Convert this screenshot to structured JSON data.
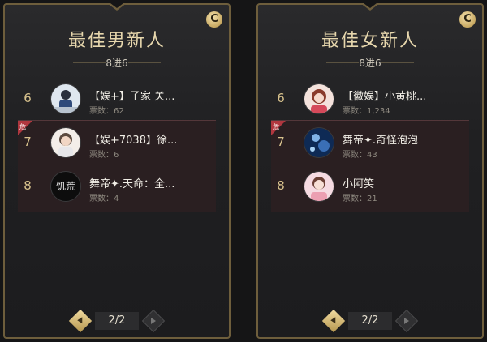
{
  "panels": [
    {
      "title": "最佳男新人",
      "subtitle": "8进6",
      "coin": "C",
      "danger_label": "危",
      "pager": "2/2",
      "nominees": [
        {
          "rank": "6",
          "name": "【娱+】子家 关...",
          "votes": "票数：62"
        },
        {
          "rank": "7",
          "name": "【娱+7038】徐...",
          "votes": "票数：6"
        },
        {
          "rank": "8",
          "name": "舞帝✦.天命：全...",
          "votes": "票数：4"
        }
      ],
      "avatar_text_8": "饥荒"
    },
    {
      "title": "最佳女新人",
      "subtitle": "8进6",
      "coin": "C",
      "danger_label": "危",
      "pager": "2/2",
      "nominees": [
        {
          "rank": "6",
          "name": "【徽娱】小黄桃...",
          "votes": "票数：1,234"
        },
        {
          "rank": "7",
          "name": "舞帝✦.奇怪泡泡",
          "votes": "票数：43"
        },
        {
          "rank": "8",
          "name": "小阿笑",
          "votes": "票数：21"
        }
      ]
    }
  ]
}
